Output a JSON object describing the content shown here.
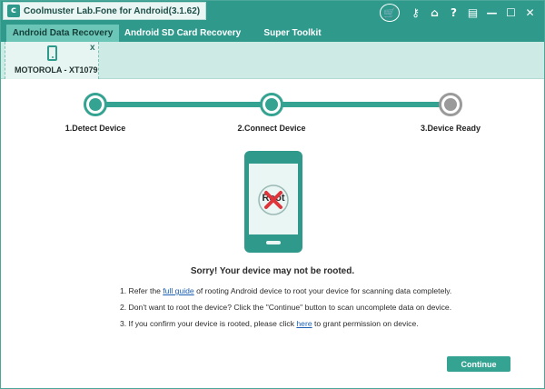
{
  "window": {
    "title": "Coolmuster Lab.Fone for Android(3.1.62)"
  },
  "titlebar_icons": [
    {
      "name": "cart-icon",
      "glyph": "🛒"
    },
    {
      "name": "key-icon",
      "glyph": "⚷"
    },
    {
      "name": "home-icon",
      "glyph": "⌂"
    },
    {
      "name": "help-icon",
      "glyph": "?"
    },
    {
      "name": "register-icon",
      "glyph": "▤"
    },
    {
      "name": "minimize-icon",
      "glyph": "—"
    },
    {
      "name": "maximize-icon",
      "glyph": "☐"
    },
    {
      "name": "close-icon",
      "glyph": "✕"
    }
  ],
  "tabs": [
    {
      "label": "Android Data Recovery",
      "active": true
    },
    {
      "label": "Android SD Card Recovery",
      "active": false
    },
    {
      "label": "Super Toolkit",
      "active": false
    }
  ],
  "device": {
    "name": "MOTOROLA - XT1079",
    "close_label": "x"
  },
  "steps": [
    {
      "label": "1.Detect Device",
      "state": "done"
    },
    {
      "label": "2.Connect Device",
      "state": "done"
    },
    {
      "label": "3.Device Ready",
      "state": "pending"
    }
  ],
  "illustration": {
    "root_text": "Root"
  },
  "message": "Sorry! Your device may not be rooted.",
  "instructions": {
    "line1_before": "1. Refer the ",
    "line1_link": "full guide",
    "line1_after": " of rooting Android device to root your device for scanning data completely.",
    "line2": "2. Don't want to root the device? Click the \"Continue\" button to scan uncomplete data on device.",
    "line3_before": "3. If you confirm your device is rooted, please click ",
    "line3_link": "here",
    "line3_after": " to grant permission on device."
  },
  "continue_label": "Continue",
  "colors": {
    "accent": "#2f9a8c",
    "progress": "#35a392",
    "pending": "#9a9a9a",
    "link": "#1a5fb4",
    "error_x": "#e0343b"
  }
}
